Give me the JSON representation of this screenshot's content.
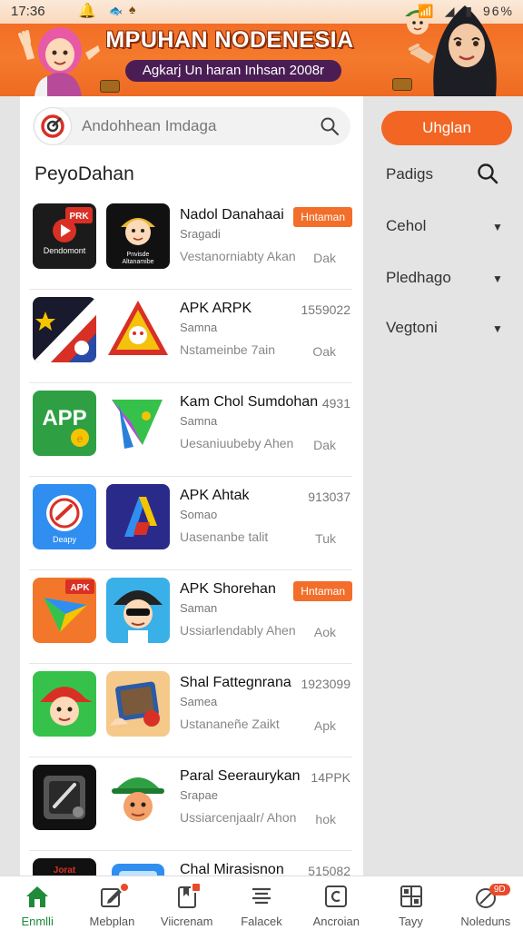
{
  "status_bar": {
    "time": "17:36",
    "battery": "96%"
  },
  "banner": {
    "title": "MPUHAN NODENESIA",
    "subtitle": "Agkarj Un haran Inhsan 2008r"
  },
  "search": {
    "placeholder": "Andohhean Imdaga"
  },
  "section_title": "PeyoDahan",
  "apps": [
    {
      "title": "Nadol Danahaai",
      "sub": "Sragadi",
      "desc": "Vestanorniabty Akan",
      "num": "",
      "tag": "Hntaman",
      "size": "Dak",
      "icon_a_text": "Dendomont",
      "icon_a_badge": "PRK",
      "icon_b_text": "Pnvisde Altanamibe"
    },
    {
      "title": "APK ARPK",
      "sub": "Samna",
      "desc": "Nstameinbe 7ain",
      "num": "1559022",
      "tag": "",
      "size": "Oak"
    },
    {
      "title": "Kam Chol Sumdohan",
      "sub": "Samna",
      "desc": "Uesaniuubeby Ahen",
      "num": "4931",
      "tag": "",
      "size": "Dak",
      "icon_a_text": "APP"
    },
    {
      "title": "APK Ahtak",
      "sub": "Somao",
      "desc": "Uasenanbe talit",
      "num": "913037",
      "tag": "",
      "size": "Tuk",
      "icon_a_text": "Deapy"
    },
    {
      "title": "APK Shorehan",
      "sub": "Saman",
      "desc": "Ussiarlendably Ahen",
      "num": "",
      "tag": "Hntaman",
      "size": "Aok",
      "icon_a_badge": "APK"
    },
    {
      "title": "Shal Fattegnrana",
      "sub": "Samea",
      "desc": "Ustananeñe Zaikt",
      "num": "1923099",
      "tag": "",
      "size": "Apk"
    },
    {
      "title": "Paral Seeraurykan",
      "sub": "Srapae",
      "desc": "Ussiarcenjaalr/ Ahon",
      "num": "14PPK",
      "tag": "",
      "size": "hok"
    },
    {
      "title": "Chal Mirasisnon",
      "sub": "",
      "desc": "",
      "num": "515082",
      "tag": "",
      "size": "",
      "icon_a_badge": "Jorat"
    }
  ],
  "right_panel": {
    "upload_label": "Uhglan",
    "filters": [
      "Padigs",
      "Cehol",
      "Pledhago",
      "Vegtoni"
    ]
  },
  "bottom_nav": [
    {
      "label": "Enmlli",
      "icon": "home-icon",
      "active": true
    },
    {
      "label": "Mebplan",
      "icon": "edit-icon"
    },
    {
      "label": "Viicrenam",
      "icon": "bookmark-icon"
    },
    {
      "label": "Falacek",
      "icon": "list-icon"
    },
    {
      "label": "Ancroian",
      "icon": "app-c-icon"
    },
    {
      "label": "Tayy",
      "icon": "grid-icon"
    },
    {
      "label": "Noleduns",
      "icon": "bell-icon",
      "badge": "9D"
    }
  ],
  "colors": {
    "accent": "#f26522",
    "active_nav": "#1e8a3a",
    "tag": "#f26e2a"
  }
}
